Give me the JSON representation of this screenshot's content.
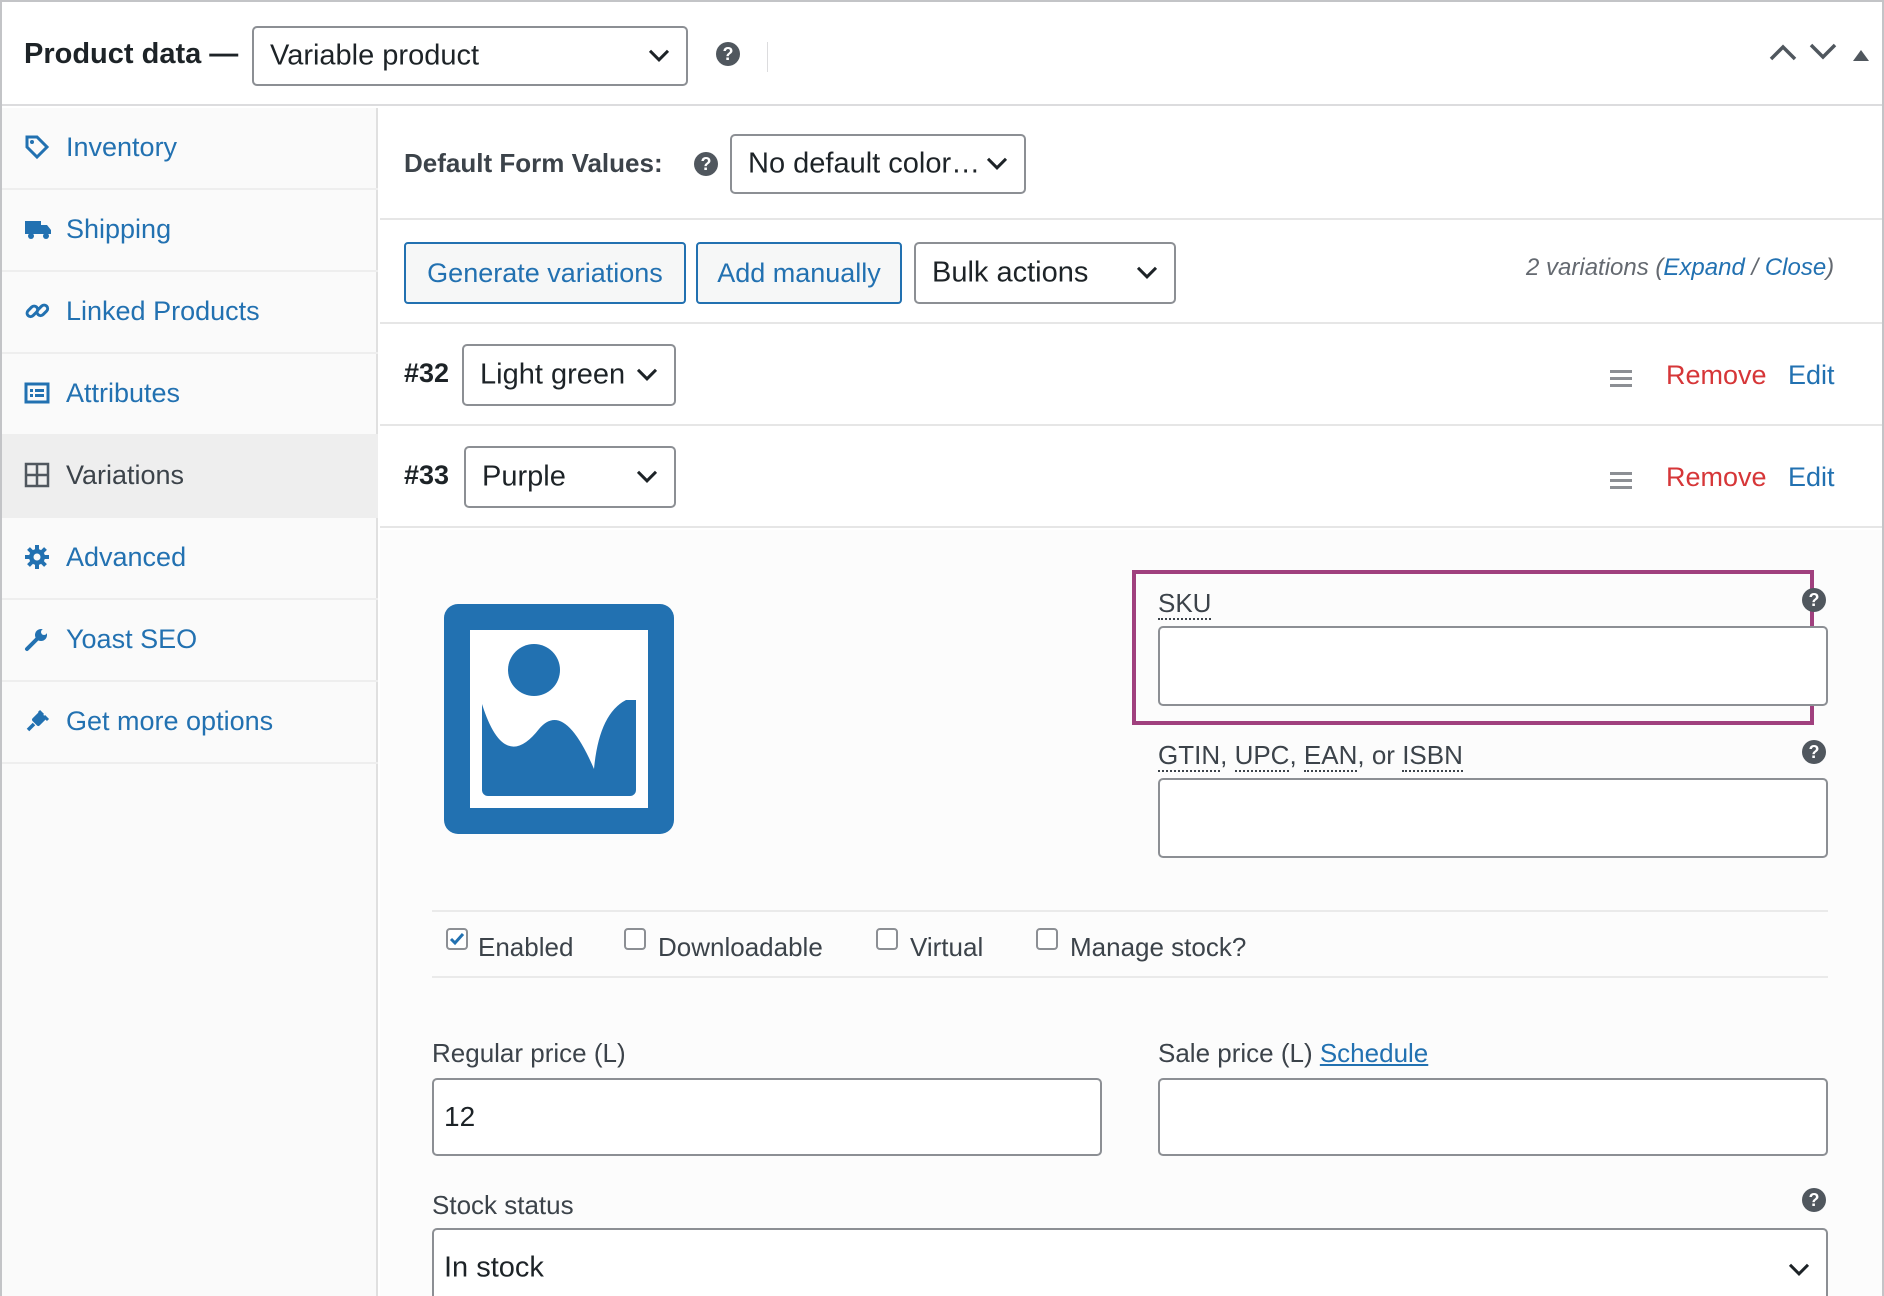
{
  "header": {
    "title": "Product data —",
    "product_type": "Variable product",
    "help": "?"
  },
  "sidebar": {
    "items": [
      {
        "label": "Inventory",
        "icon": "tag-icon"
      },
      {
        "label": "Shipping",
        "icon": "truck-icon"
      },
      {
        "label": "Linked Products",
        "icon": "link-icon"
      },
      {
        "label": "Attributes",
        "icon": "list-card-icon"
      },
      {
        "label": "Variations",
        "icon": "grid-icon",
        "active": true
      },
      {
        "label": "Advanced",
        "icon": "gear-icon"
      },
      {
        "label": "Yoast SEO",
        "icon": "wrench-icon"
      },
      {
        "label": "Get more options",
        "icon": "plugin-icon"
      }
    ]
  },
  "defaults": {
    "label": "Default Form Values:",
    "value": "No default color…",
    "help": "?"
  },
  "toolbar": {
    "generate_label": "Generate variations",
    "add_label": "Add manually",
    "bulk_value": "Bulk actions",
    "count_text": "2 variations (",
    "expand": "Expand",
    "slash": " / ",
    "close": "Close",
    "paren_close": ")"
  },
  "variations": [
    {
      "id": "#32",
      "value": "Light green",
      "remove": "Remove",
      "edit": "Edit"
    },
    {
      "id": "#33",
      "value": "Purple",
      "remove": "Remove",
      "edit": "Edit"
    }
  ],
  "variation_form": {
    "image_icon": "image-placeholder-icon",
    "sku_label": "SKU",
    "sku_value": "",
    "gtin_parts": [
      "GTIN",
      ", ",
      "UPC",
      ", ",
      "EAN",
      ", or ",
      "ISBN"
    ],
    "gtin_value": "",
    "options": [
      {
        "label": "Enabled",
        "checked": true
      },
      {
        "label": "Downloadable",
        "checked": false
      },
      {
        "label": "Virtual",
        "checked": false
      },
      {
        "label": "Manage stock?",
        "checked": false
      }
    ],
    "regular_price_label": "Regular price (L)",
    "regular_price_value": "12",
    "sale_price_label": "Sale price (L) ",
    "schedule_link": "Schedule",
    "sale_price_value": "",
    "stock_status_label": "Stock status",
    "stock_status_value": "In stock",
    "help": "?"
  },
  "colors": {
    "link": "#2271b1",
    "remove": "#d63638",
    "highlight": "#a0407e"
  }
}
